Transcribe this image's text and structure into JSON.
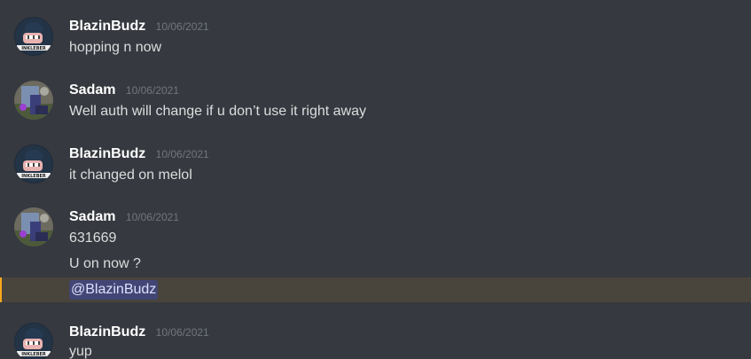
{
  "messages": [
    {
      "username": "BlazinBudz",
      "timestamp": "10/06/2021",
      "avatar_icon": "blazinbudz-avatar-icon",
      "lines": [
        "hopping n now"
      ]
    },
    {
      "username": "Sadam",
      "timestamp": "10/06/2021",
      "avatar_icon": "sadam-avatar-icon",
      "lines": [
        "Well auth will change if u don’t use it right away"
      ]
    },
    {
      "username": "BlazinBudz",
      "timestamp": "10/06/2021",
      "avatar_icon": "blazinbudz-avatar-icon",
      "lines": [
        "it changed on melol"
      ]
    },
    {
      "username": "Sadam",
      "timestamp": "10/06/2021",
      "avatar_icon": "sadam-avatar-icon",
      "lines": [
        "631669",
        "U on now ?"
      ],
      "mention": "@BlazinBudz"
    },
    {
      "username": "BlazinBudz",
      "timestamp": "10/06/2021",
      "avatar_icon": "blazinbudz-avatar-icon",
      "lines": [
        "yup"
      ]
    }
  ],
  "colors": {
    "background": "#36393f",
    "username": "#ffffff",
    "timestamp": "#72767d",
    "message_text": "#dcddde",
    "mention_highlight_bg": "#49443c",
    "mention_highlight_border": "#faa81a",
    "mention_pill_bg": "#414675",
    "mention_pill_text": "#dee0fc"
  }
}
